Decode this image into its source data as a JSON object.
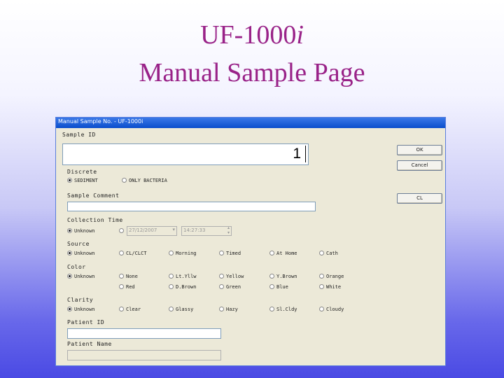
{
  "slide": {
    "title_line1_main": "UF-1000",
    "title_line1_italic": "i",
    "title_line2": "Manual Sample Page"
  },
  "window": {
    "title": "Manual Sample No. - UF-1000i"
  },
  "form": {
    "sample_id_label": "Sample ID",
    "sample_id_value": "1",
    "discrete_label": "Discrete",
    "discrete_options": [
      "SEDIMENT",
      "ONLY BACTERIA"
    ],
    "sample_comment_label": "Sample Comment",
    "collection_time_label": "Collection Time",
    "collection_unknown": "Unknown",
    "collection_date": "27/12/2007",
    "collection_time": "14:27:33",
    "source_label": "Source",
    "source_options": [
      "Unknown",
      "CL/CLCT",
      "Morning",
      "Timed",
      "At Home",
      "Cath"
    ],
    "color_label": "Color",
    "color_row1": [
      "Unknown",
      "None",
      "Lt.Yllw",
      "Yellow",
      "Y.Brown",
      "Orange"
    ],
    "color_row2": [
      "Red",
      "D.Brown",
      "Green",
      "Blue",
      "White"
    ],
    "clarity_label": "Clarity",
    "clarity_options": [
      "Unknown",
      "Clear",
      "Glassy",
      "Hazy",
      "Sl.Cldy",
      "Cloudy"
    ],
    "patient_id_label": "Patient ID",
    "patient_name_label": "Patient Name"
  },
  "buttons": {
    "ok": "OK",
    "cancel": "Cancel",
    "clear": "CL"
  }
}
